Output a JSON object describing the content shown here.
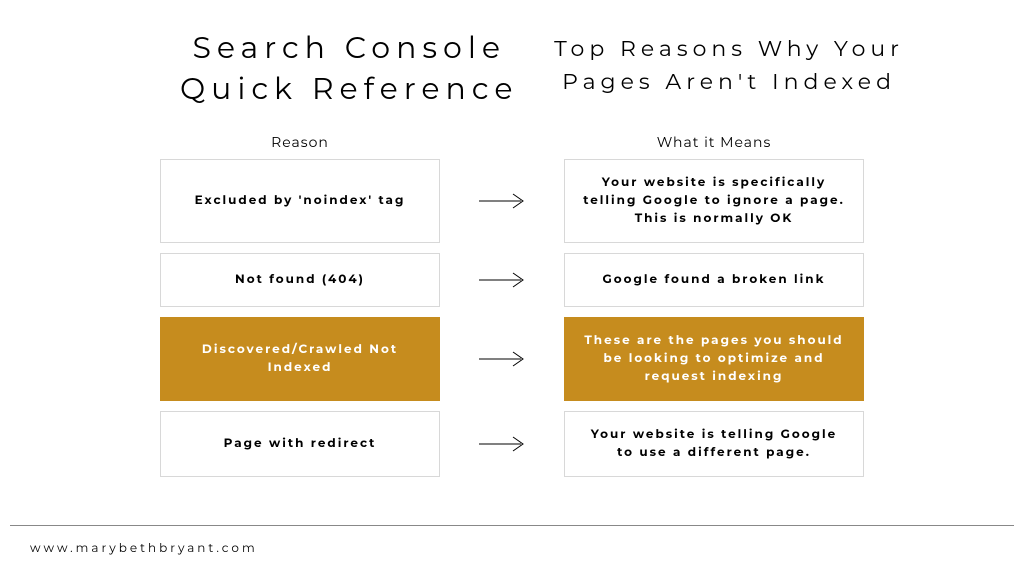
{
  "header": {
    "title_left": "Search Console\nQuick Reference",
    "title_right": "Top Reasons Why Your\nPages Aren't Indexed"
  },
  "columns": {
    "left": "Reason",
    "right": "What it Means"
  },
  "rows": [
    {
      "reason": "Excluded by 'noindex' tag",
      "meaning": "Your website is specifically telling Google to ignore a page. This is normally OK",
      "highlight": false
    },
    {
      "reason": "Not found (404)",
      "meaning": "Google found a broken link",
      "highlight": false
    },
    {
      "reason": "Discovered/Crawled Not Indexed",
      "meaning": "These are the pages you should be looking to optimize and request indexing",
      "highlight": true
    },
    {
      "reason": "Page with redirect",
      "meaning": "Your website is telling Google to use a different page.",
      "highlight": false
    }
  ],
  "footer": {
    "url": "www.marybethbryant.com"
  },
  "colors": {
    "highlight_bg": "#C68C1E"
  }
}
